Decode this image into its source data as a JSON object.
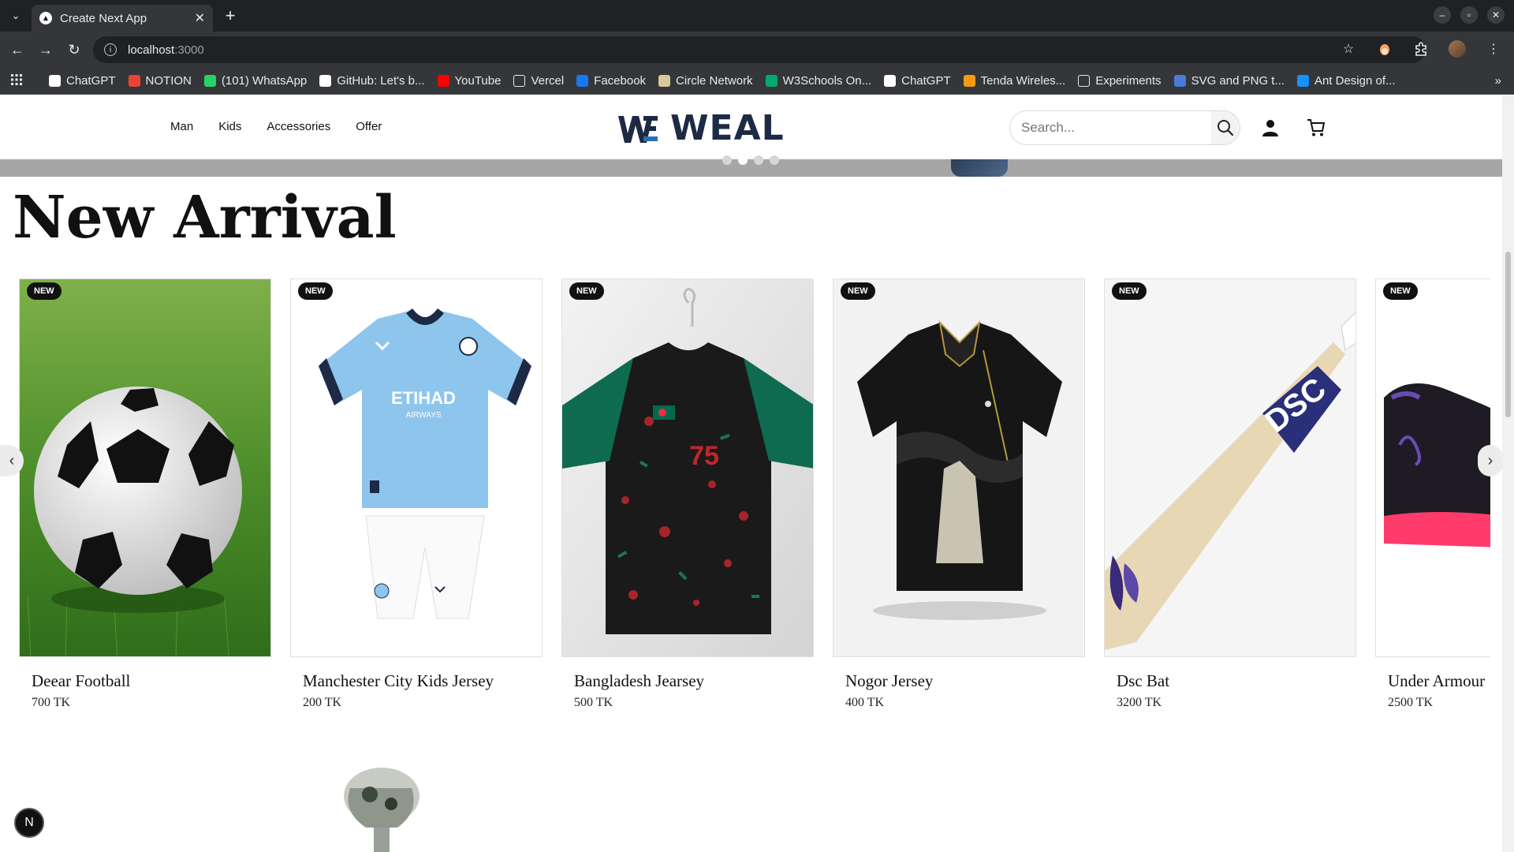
{
  "browser": {
    "tab_title": "Create Next App",
    "url_host": "localhost",
    "url_port": ":3000",
    "bookmarks": [
      {
        "label": "ChatGPT",
        "icon": "chatgpt-icon",
        "color": "#ffffff"
      },
      {
        "label": "NOTION",
        "icon": "code-icon",
        "color": "#ea4335"
      },
      {
        "label": "(101) WhatsApp",
        "icon": "whatsapp-icon",
        "color": "#25d366"
      },
      {
        "label": "GitHub: Let's b...",
        "icon": "github-icon",
        "color": "#ffffff"
      },
      {
        "label": "YouTube",
        "icon": "youtube-icon",
        "color": "#ff0000"
      },
      {
        "label": "Vercel",
        "icon": "folder-icon",
        "color": "#e8eaed"
      },
      {
        "label": "Facebook",
        "icon": "facebook-icon",
        "color": "#1877f2"
      },
      {
        "label": "Circle Network",
        "icon": "circle-network-icon",
        "color": "#d9c89c"
      },
      {
        "label": "W3Schools On...",
        "icon": "w3schools-icon",
        "color": "#04aa6d"
      },
      {
        "label": "ChatGPT",
        "icon": "chatgpt-icon",
        "color": "#ffffff"
      },
      {
        "label": "Tenda Wireles...",
        "icon": "tenda-icon",
        "color": "#f39c12"
      },
      {
        "label": "Experiments",
        "icon": "flask-icon",
        "color": "#e8eaed"
      },
      {
        "label": "SVG and PNG t...",
        "icon": "svg-icon",
        "color": "#4a7bd9"
      },
      {
        "label": "Ant Design of...",
        "icon": "ant-design-icon",
        "color": "#1890ff"
      }
    ]
  },
  "site": {
    "nav": [
      "Man",
      "Kids",
      "Accessories",
      "Offer"
    ],
    "logo_text": "WEAL",
    "search_placeholder": "Search...",
    "section_title": "New Arrival",
    "badge_label": "NEW",
    "colors": {
      "logo": "#1c2a45",
      "badge": "#111111"
    }
  },
  "products": [
    {
      "name": "Deear Football",
      "price": "700 TK"
    },
    {
      "name": "Manchester City Kids Jersey",
      "price": "200 TK"
    },
    {
      "name": "Bangladesh Jearsey",
      "price": "500 TK"
    },
    {
      "name": "Nogor Jersey",
      "price": "400 TK"
    },
    {
      "name": "Dsc Bat",
      "price": "3200 TK"
    },
    {
      "name": "Under Armour",
      "price": "2500 TK"
    }
  ],
  "jersey_number": "75",
  "next_badge": "N"
}
